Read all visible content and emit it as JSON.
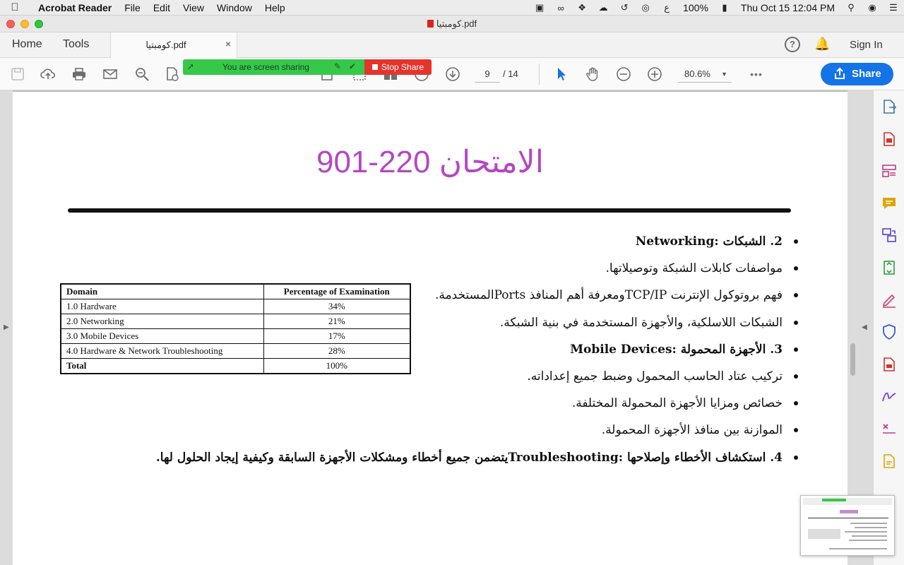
{
  "menubar": {
    "app_name": "Acrobat Reader",
    "menus": [
      "File",
      "Edit",
      "View",
      "Window",
      "Help"
    ],
    "battery": "100%",
    "clock": "Thu Oct 15  12:04 PM",
    "input_lang": "ع"
  },
  "window": {
    "title": "كومبتيا.pdf"
  },
  "tabs": {
    "home": "Home",
    "tools": "Tools",
    "document": "كومبتيا.pdf",
    "close": "×",
    "help": "?",
    "sign_in": "Sign In"
  },
  "toolbar": {
    "page_current": "9",
    "page_total": "/  14",
    "zoom": "80.6%",
    "share_label": "Share",
    "more": "•••"
  },
  "screen_share": {
    "message": "You are screen sharing",
    "stop_label": "Stop Share"
  },
  "document": {
    "title": "الامتحان 220-901",
    "bullets": [
      {
        "text": "2. الشبكات :Networking",
        "heading": true
      },
      {
        "text": "مواصفات كابلات الشبكة وتوصيلاتها.",
        "heading": false
      },
      {
        "text": "فهم بروتوكول الإنترنت  TCP/IPومعرفة أهم المنافذ  Portsالمستخدمة.",
        "heading": false
      },
      {
        "text": "الشبكات اللاسلكية، والأجهزة المستخدمة في بنية الشبكة.",
        "heading": false
      },
      {
        "text": "3. الأجهزة المحمولة :Mobile Devices",
        "heading": true
      },
      {
        "text": "تركيب عتاد الحاسب المحمول وضبط جميع إعداداته.",
        "heading": false
      },
      {
        "text": "خصائص ومزايا الأجهزة المحمولة المختلفة.",
        "heading": false
      },
      {
        "text": "الموازنة بين منافذ الأجهزة المحمولة.",
        "heading": false
      },
      {
        "text": "4. استكشاف الأخطاء وإصلاحها  :Troubleshootingيتضمن جميع أخطاء ومشكلات الأجهزة السابقة وكيفية إيجاد الحلول لها.",
        "heading": true
      }
    ],
    "table": {
      "headers": [
        "Domain",
        "Percentage of Examination"
      ],
      "rows": [
        [
          "1.0 Hardware",
          "34%"
        ],
        [
          "2.0 Networking",
          "21%"
        ],
        [
          "3.0 Mobile Devices",
          "17%"
        ],
        [
          "4.0 Hardware & Network Troubleshooting",
          "28%"
        ]
      ],
      "total": [
        "Total",
        "100%"
      ]
    }
  },
  "colors": {
    "title_purple": "#b547c2",
    "share_blue": "#1473e6",
    "banner_green": "#36c84b",
    "stop_red": "#e5342c"
  },
  "rail_icons": [
    "export-pdf-icon",
    "create-pdf-icon",
    "organize-pages-icon",
    "comment-icon",
    "combine-files-icon",
    "compress-icon",
    "fill-sign-icon",
    "protect-icon",
    "redact-icon",
    "request-signature-icon",
    "edit-text-icon",
    "send-for-comments-icon"
  ]
}
